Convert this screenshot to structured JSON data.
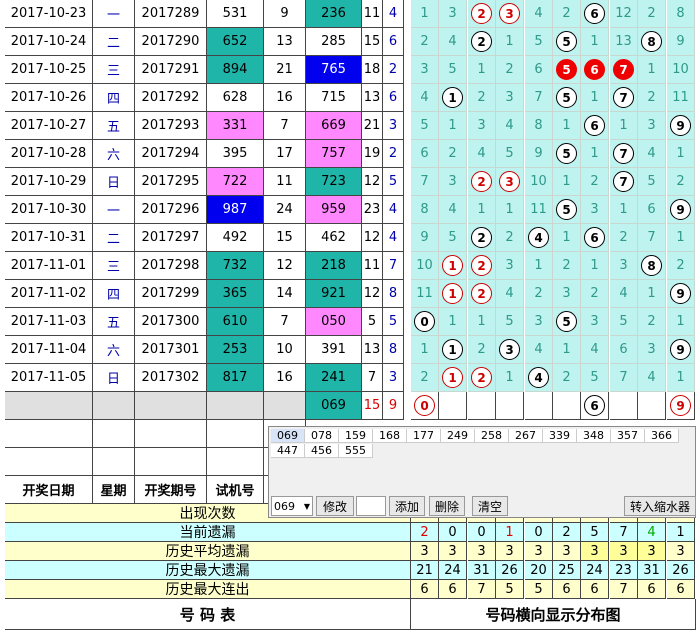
{
  "colors": {
    "teal": "#1fb5a8",
    "pink": "#ff88ff",
    "blue": "#0000ee",
    "dist_bg": "#bff3ef",
    "dist_fg": "#2e9a8a",
    "yellow": "#ffffcc",
    "cyan": "#ccffff",
    "red": "#e00000"
  },
  "rows": [
    {
      "date": "2017-10-23",
      "wk": "一",
      "issue": "2017289",
      "a": "531",
      "b": "9",
      "c": "236",
      "d": "11",
      "e": "4",
      "dist": [
        {
          "v": "1"
        },
        {
          "v": "3"
        },
        {
          "v": "2",
          "b": "r"
        },
        {
          "v": "3",
          "b": "r"
        },
        {
          "v": "4"
        },
        {
          "v": "2"
        },
        {
          "v": "6",
          "b": "w"
        },
        {
          "v": "12"
        },
        {
          "v": "2"
        },
        {
          "v": "8"
        }
      ]
    },
    {
      "date": "2017-10-24",
      "wk": "二",
      "issue": "2017290",
      "a": "652",
      "b": "13",
      "c": "285",
      "d": "15",
      "e": "6",
      "dist": [
        {
          "v": "2"
        },
        {
          "v": "4"
        },
        {
          "v": "2",
          "b": "w"
        },
        {
          "v": "1"
        },
        {
          "v": "5"
        },
        {
          "v": "5",
          "b": "w"
        },
        {
          "v": "1"
        },
        {
          "v": "13"
        },
        {
          "v": "8",
          "b": "w"
        },
        {
          "v": "9"
        }
      ]
    },
    {
      "date": "2017-10-25",
      "wk": "三",
      "issue": "2017291",
      "a": "894",
      "b": "21",
      "c": "765",
      "d": "18",
      "e": "2",
      "dist": [
        {
          "v": "3"
        },
        {
          "v": "5"
        },
        {
          "v": "1"
        },
        {
          "v": "2"
        },
        {
          "v": "6"
        },
        {
          "v": "5",
          "b": "f"
        },
        {
          "v": "6",
          "b": "f"
        },
        {
          "v": "7",
          "b": "f"
        },
        {
          "v": "1"
        },
        {
          "v": "10"
        }
      ]
    },
    {
      "date": "2017-10-26",
      "wk": "四",
      "issue": "2017292",
      "a": "628",
      "b": "16",
      "c": "715",
      "d": "13",
      "e": "6",
      "dist": [
        {
          "v": "4"
        },
        {
          "v": "1",
          "b": "w"
        },
        {
          "v": "2"
        },
        {
          "v": "3"
        },
        {
          "v": "7"
        },
        {
          "v": "5",
          "b": "w"
        },
        {
          "v": "1"
        },
        {
          "v": "7",
          "b": "w"
        },
        {
          "v": "2"
        },
        {
          "v": "11"
        }
      ]
    },
    {
      "date": "2017-10-27",
      "wk": "五",
      "issue": "2017293",
      "a": "331",
      "b": "7",
      "c": "669",
      "d": "21",
      "e": "3",
      "dist": [
        {
          "v": "5"
        },
        {
          "v": "1"
        },
        {
          "v": "3"
        },
        {
          "v": "4"
        },
        {
          "v": "8"
        },
        {
          "v": "1"
        },
        {
          "v": "6",
          "b": "w"
        },
        {
          "v": "1"
        },
        {
          "v": "3"
        },
        {
          "v": "9",
          "b": "w"
        }
      ]
    },
    {
      "date": "2017-10-28",
      "wk": "六",
      "issue": "2017294",
      "a": "395",
      "b": "17",
      "c": "757",
      "d": "19",
      "e": "2",
      "dist": [
        {
          "v": "6"
        },
        {
          "v": "2"
        },
        {
          "v": "4"
        },
        {
          "v": "5"
        },
        {
          "v": "9"
        },
        {
          "v": "5",
          "b": "w"
        },
        {
          "v": "1"
        },
        {
          "v": "7",
          "b": "w"
        },
        {
          "v": "4"
        },
        {
          "v": "1"
        }
      ]
    },
    {
      "date": "2017-10-29",
      "wk": "日",
      "issue": "2017295",
      "a": "722",
      "b": "11",
      "c": "723",
      "d": "12",
      "e": "5",
      "dist": [
        {
          "v": "7"
        },
        {
          "v": "3"
        },
        {
          "v": "2",
          "b": "r"
        },
        {
          "v": "3",
          "b": "r"
        },
        {
          "v": "10"
        },
        {
          "v": "1"
        },
        {
          "v": "2"
        },
        {
          "v": "7",
          "b": "w"
        },
        {
          "v": "5"
        },
        {
          "v": "2"
        }
      ]
    },
    {
      "date": "2017-10-30",
      "wk": "一",
      "issue": "2017296",
      "a": "987",
      "b": "24",
      "c": "959",
      "d": "23",
      "e": "4",
      "dist": [
        {
          "v": "8"
        },
        {
          "v": "4"
        },
        {
          "v": "1"
        },
        {
          "v": "1"
        },
        {
          "v": "11"
        },
        {
          "v": "5",
          "b": "w"
        },
        {
          "v": "3"
        },
        {
          "v": "1"
        },
        {
          "v": "6"
        },
        {
          "v": "9",
          "b": "w"
        }
      ]
    },
    {
      "date": "2017-10-31",
      "wk": "二",
      "issue": "2017297",
      "a": "492",
      "b": "15",
      "c": "462",
      "d": "12",
      "e": "4",
      "dist": [
        {
          "v": "9"
        },
        {
          "v": "5"
        },
        {
          "v": "2",
          "b": "w"
        },
        {
          "v": "2"
        },
        {
          "v": "4",
          "b": "w"
        },
        {
          "v": "1"
        },
        {
          "v": "6",
          "b": "w"
        },
        {
          "v": "2"
        },
        {
          "v": "7"
        },
        {
          "v": "1"
        }
      ]
    },
    {
      "date": "2017-11-01",
      "wk": "三",
      "issue": "2017298",
      "a": "732",
      "b": "12",
      "c": "218",
      "d": "11",
      "e": "7",
      "dist": [
        {
          "v": "10"
        },
        {
          "v": "1",
          "b": "r"
        },
        {
          "v": "2",
          "b": "r"
        },
        {
          "v": "3"
        },
        {
          "v": "1"
        },
        {
          "v": "2"
        },
        {
          "v": "1"
        },
        {
          "v": "3"
        },
        {
          "v": "8",
          "b": "w"
        },
        {
          "v": "2"
        }
      ]
    },
    {
      "date": "2017-11-02",
      "wk": "四",
      "issue": "2017299",
      "a": "365",
      "b": "14",
      "c": "921",
      "d": "12",
      "e": "8",
      "dist": [
        {
          "v": "11"
        },
        {
          "v": "1",
          "b": "r"
        },
        {
          "v": "2",
          "b": "r"
        },
        {
          "v": "4"
        },
        {
          "v": "2"
        },
        {
          "v": "3"
        },
        {
          "v": "2"
        },
        {
          "v": "4"
        },
        {
          "v": "1"
        },
        {
          "v": "9",
          "b": "w"
        }
      ]
    },
    {
      "date": "2017-11-03",
      "wk": "五",
      "issue": "2017300",
      "a": "610",
      "b": "7",
      "c": "050",
      "d": "5",
      "e": "5",
      "dist": [
        {
          "v": "0",
          "b": "w"
        },
        {
          "v": "1"
        },
        {
          "v": "1"
        },
        {
          "v": "5"
        },
        {
          "v": "3"
        },
        {
          "v": "5",
          "b": "w"
        },
        {
          "v": "3"
        },
        {
          "v": "5"
        },
        {
          "v": "2"
        },
        {
          "v": "1"
        }
      ]
    },
    {
      "date": "2017-11-04",
      "wk": "六",
      "issue": "2017301",
      "a": "253",
      "b": "10",
      "c": "391",
      "d": "13",
      "e": "8",
      "dist": [
        {
          "v": "1"
        },
        {
          "v": "1",
          "b": "w"
        },
        {
          "v": "2"
        },
        {
          "v": "3",
          "b": "w"
        },
        {
          "v": "4"
        },
        {
          "v": "1"
        },
        {
          "v": "4"
        },
        {
          "v": "6"
        },
        {
          "v": "3"
        },
        {
          "v": "9",
          "b": "w"
        }
      ]
    },
    {
      "date": "2017-11-05",
      "wk": "日",
      "issue": "2017302",
      "a": "817",
      "b": "16",
      "c": "241",
      "d": "7",
      "e": "3",
      "dist": [
        {
          "v": "2"
        },
        {
          "v": "1",
          "b": "r"
        },
        {
          "v": "2",
          "b": "r"
        },
        {
          "v": "1"
        },
        {
          "v": "4",
          "b": "w"
        },
        {
          "v": "2"
        },
        {
          "v": "5"
        },
        {
          "v": "7"
        },
        {
          "v": "4"
        },
        {
          "v": "1"
        }
      ]
    }
  ],
  "predict": {
    "num": "069",
    "sum": "15",
    "span": "9",
    "balls": [
      "0",
      "",
      "",
      "",
      "",
      "",
      "6",
      "",
      "",
      "9"
    ]
  },
  "headers": {
    "date": "开奖日期",
    "wk": "星期",
    "issue": "开奖期号",
    "trial": "试机号"
  },
  "stats": [
    {
      "label": "出现次数",
      "vals": [
        "",
        "",
        "",
        "",
        "",
        "",
        "",
        "",
        "",
        ""
      ]
    },
    {
      "label": "当前遗漏",
      "vals": [
        "2",
        "0",
        "0",
        "1",
        "0",
        "2",
        "5",
        "7",
        "4",
        "1"
      ]
    },
    {
      "label": "历史平均遗漏",
      "vals": [
        "3",
        "3",
        "3",
        "3",
        "3",
        "3",
        "3",
        "3",
        "3",
        "3"
      ]
    },
    {
      "label": "历史最大遗漏",
      "vals": [
        "21",
        "24",
        "31",
        "26",
        "20",
        "25",
        "24",
        "23",
        "31",
        "26"
      ]
    },
    {
      "label": "历史最大连出",
      "vals": [
        "6",
        "6",
        "7",
        "5",
        "5",
        "6",
        "6",
        "7",
        "6",
        "6"
      ]
    }
  ],
  "footer": {
    "left": "号   码   表",
    "right": "号码横向显示分布图"
  },
  "panel": {
    "chips_row1": [
      "069",
      "078",
      "159",
      "168",
      "177",
      "249",
      "258",
      "267",
      "339",
      "348",
      "357",
      "366"
    ],
    "chips_row2": [
      "447",
      "456",
      "555"
    ],
    "select_value": "069",
    "btn_modify": "修改",
    "btn_add": "添加",
    "btn_delete": "删除",
    "btn_clear": "清空",
    "btn_shrink": "转入缩水器"
  }
}
